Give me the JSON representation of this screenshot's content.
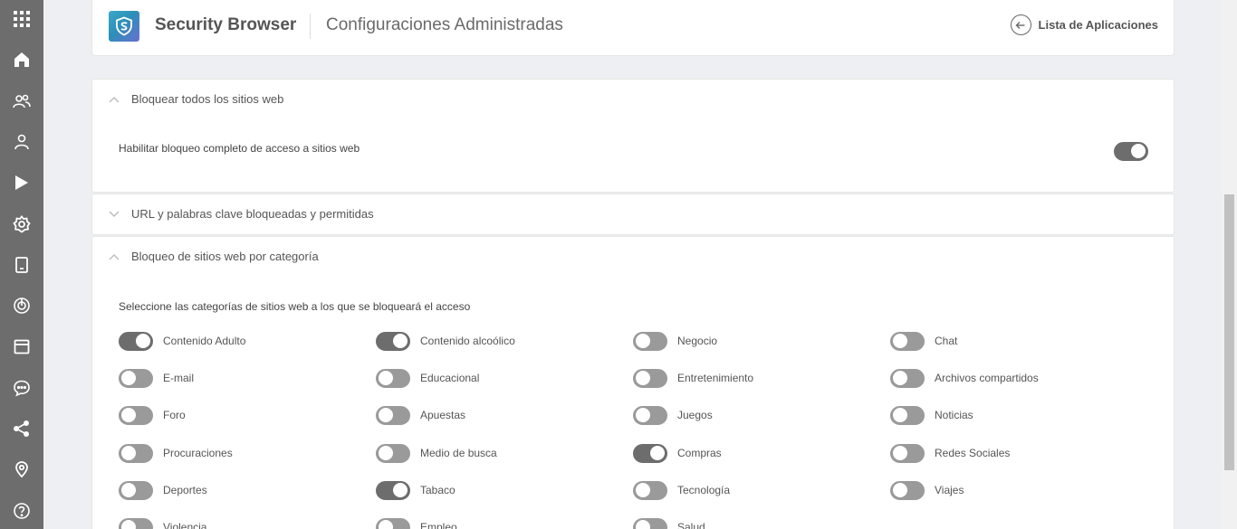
{
  "header": {
    "app_title": "Security Browser",
    "page_title": "Configuraciones Administradas",
    "back_label": "Lista de Aplicaciones"
  },
  "sidebar": {
    "icons": [
      "apps-grid-icon",
      "dashboard-icon",
      "users-icon",
      "user-icon",
      "play-store-icon",
      "settings-icon",
      "device-icon",
      "radar-icon",
      "calendar-icon",
      "chat-icon",
      "share-icon",
      "location-icon",
      "help-icon"
    ]
  },
  "sections": {
    "block_all": {
      "title": "Bloquear todos los sitios web",
      "expanded": true,
      "option_label": "Habilitar bloqueo completo de acceso a sitios web",
      "option_on": true
    },
    "url_keywords": {
      "title": "URL y palabras clave bloqueadas y permitidas",
      "expanded": false
    },
    "by_category": {
      "title": "Bloqueo de sitios web por categoría",
      "expanded": true,
      "description": "Seleccione las categorías de sitios web a los que se bloqueará el acceso",
      "categories": [
        {
          "label": "Contenido Adulto",
          "on": true
        },
        {
          "label": "Contenido alcoólico",
          "on": true
        },
        {
          "label": "Negocio",
          "on": false
        },
        {
          "label": "Chat",
          "on": false
        },
        {
          "label": "E-mail",
          "on": false
        },
        {
          "label": "Educacional",
          "on": false
        },
        {
          "label": "Entretenimiento",
          "on": false
        },
        {
          "label": "Archivos compartidos",
          "on": false
        },
        {
          "label": "Foro",
          "on": false
        },
        {
          "label": "Apuestas",
          "on": false
        },
        {
          "label": "Juegos",
          "on": false
        },
        {
          "label": "Noticias",
          "on": false
        },
        {
          "label": "Procuraciones",
          "on": false
        },
        {
          "label": "Medio de busca",
          "on": false
        },
        {
          "label": "Compras",
          "on": true
        },
        {
          "label": "Redes Sociales",
          "on": false
        },
        {
          "label": "Deportes",
          "on": false
        },
        {
          "label": "Tabaco",
          "on": true
        },
        {
          "label": "Tecnología",
          "on": false
        },
        {
          "label": "Viajes",
          "on": false
        },
        {
          "label": "Violencia",
          "on": false
        },
        {
          "label": "Empleo",
          "on": false
        },
        {
          "label": "Salud",
          "on": false
        }
      ]
    }
  },
  "colors": {
    "sidebar": "#6d6d6d",
    "toggle_on": "#6d6d6d",
    "toggle_off": "#9a9a9a",
    "page_bg": "#eeeff2"
  }
}
